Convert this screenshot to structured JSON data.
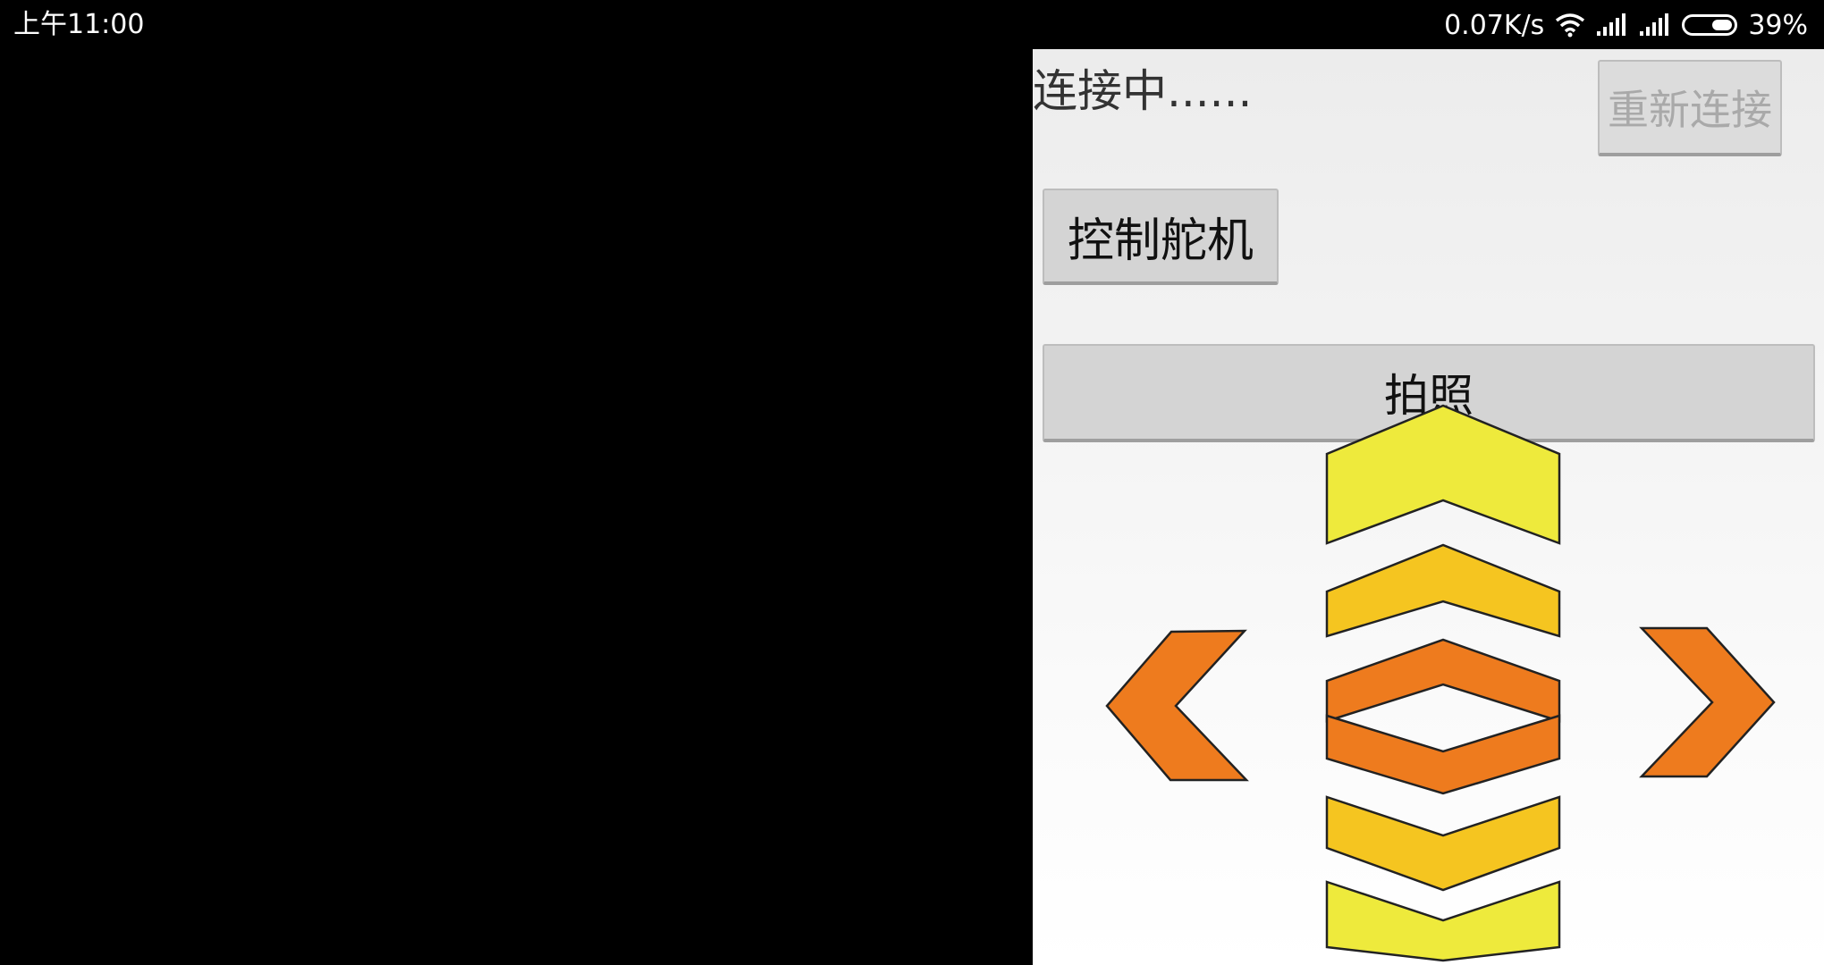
{
  "status_bar": {
    "time": "上午11:00",
    "net_speed": "0.07K/s",
    "battery_pct": "39%",
    "icons": [
      "wifi-icon",
      "signal-icon",
      "signal-icon",
      "battery-icon"
    ]
  },
  "panel": {
    "connect_status": "连接中......",
    "reconnect_label": "重新连接",
    "servo_label": "控制舵机",
    "photo_label": "拍照"
  },
  "controls": {
    "icons": [
      "chevron-up-icon",
      "chevron-up-icon",
      "center-diamond-icon",
      "chevron-down-icon",
      "chevron-down-icon",
      "chevron-left-icon",
      "chevron-right-icon"
    ],
    "colors": {
      "light_yellow": "#eeea3c",
      "yellow": "#f5c520",
      "orange": "#ee7b1e",
      "outline": "#222222"
    }
  }
}
